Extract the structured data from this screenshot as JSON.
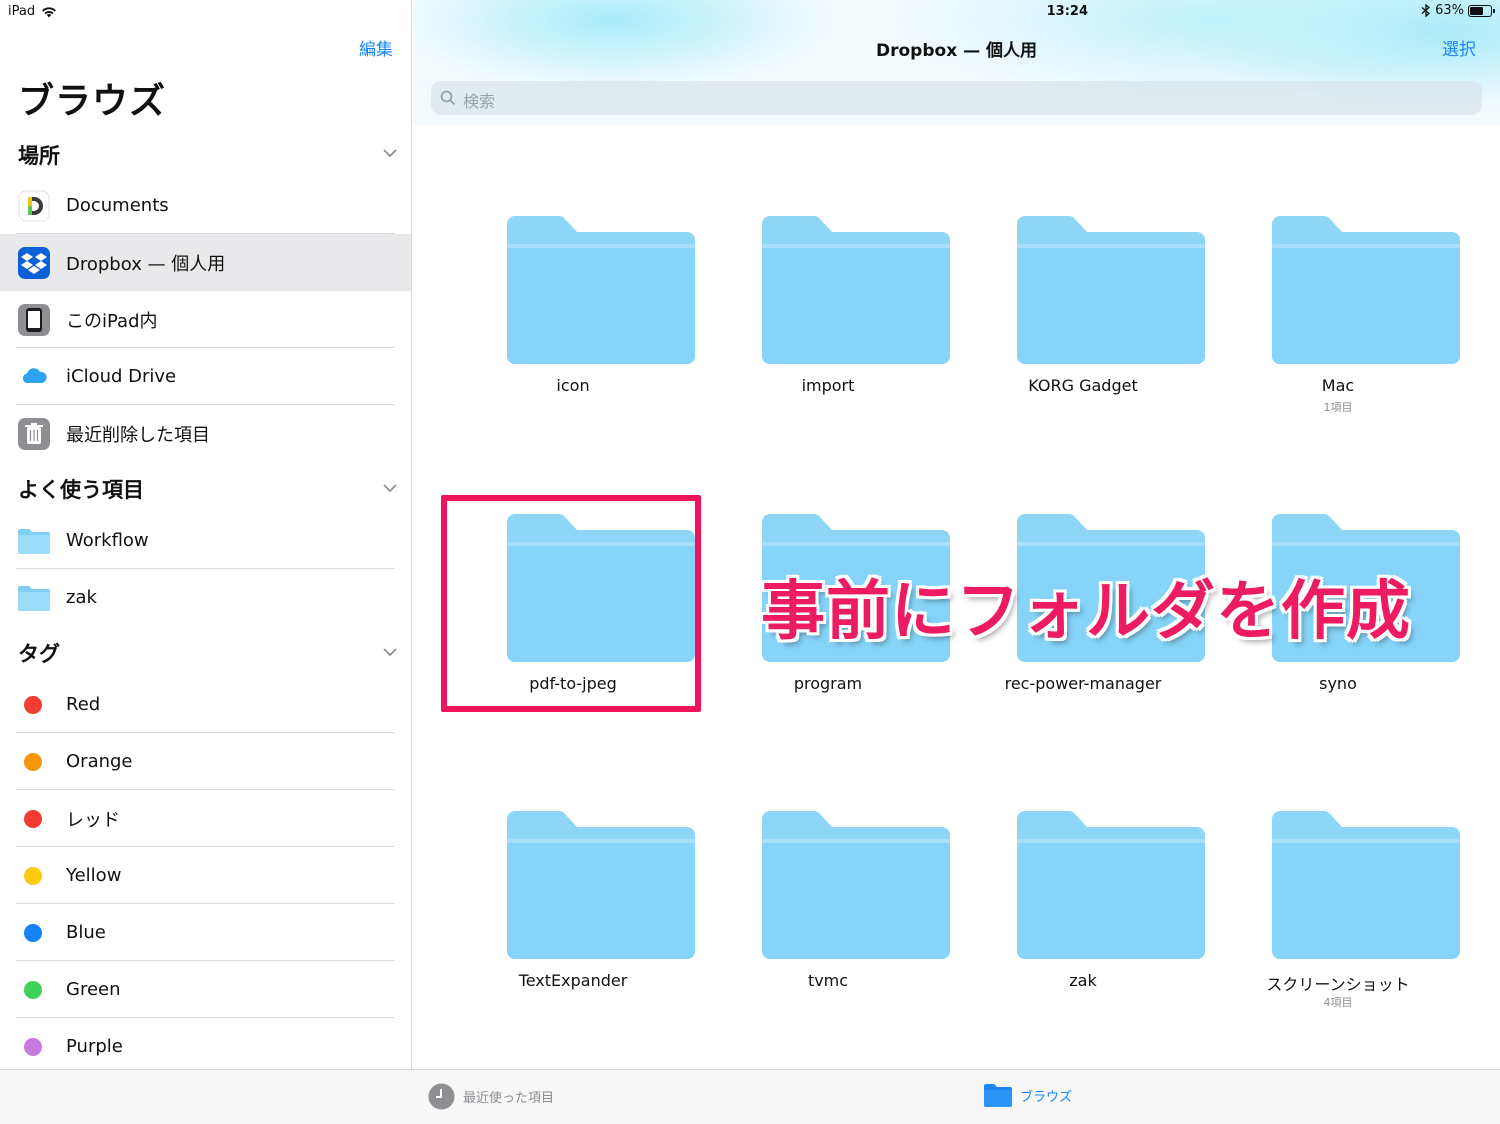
{
  "status": {
    "device": "iPad",
    "time": "13:24",
    "battery": "63%"
  },
  "sidebar": {
    "edit_label": "編集",
    "title": "ブラウズ",
    "locations_header": "場所",
    "locations": [
      {
        "label": "Documents",
        "icon": "documents-app-icon"
      },
      {
        "label": "Dropbox — 個人用",
        "icon": "dropbox-icon",
        "selected": true
      },
      {
        "label": "このiPad内",
        "icon": "ipad-icon"
      },
      {
        "label": "iCloud Drive",
        "icon": "icloud-icon"
      },
      {
        "label": "最近削除した項目",
        "icon": "trash-icon"
      }
    ],
    "favorites_header": "よく使う項目",
    "favorites": [
      {
        "label": "Workflow",
        "icon": "folder-icon"
      },
      {
        "label": "zak",
        "icon": "folder-icon"
      }
    ],
    "tags_header": "タグ",
    "tags": [
      {
        "label": "Red",
        "color": "#f23c32"
      },
      {
        "label": "Orange",
        "color": "#f7950d"
      },
      {
        "label": "レッド",
        "color": "#f23c32"
      },
      {
        "label": "Yellow",
        "color": "#fccb0f"
      },
      {
        "label": "Blue",
        "color": "#1582f5"
      },
      {
        "label": "Green",
        "color": "#3dd258"
      },
      {
        "label": "Purple",
        "color": "#c97ae0"
      }
    ]
  },
  "main": {
    "title": "Dropbox — 個人用",
    "select_label": "選択",
    "search_placeholder": "検索",
    "folders": [
      {
        "name": "icon",
        "sub": ""
      },
      {
        "name": "import",
        "sub": ""
      },
      {
        "name": "KORG Gadget",
        "sub": ""
      },
      {
        "name": "Mac",
        "sub": "1項目"
      },
      {
        "name": "pdf-to-jpeg",
        "sub": ""
      },
      {
        "name": "program",
        "sub": ""
      },
      {
        "name": "rec-power-manager",
        "sub": ""
      },
      {
        "name": "syno",
        "sub": ""
      },
      {
        "name": "TextExpander",
        "sub": ""
      },
      {
        "name": "tvmc",
        "sub": ""
      },
      {
        "name": "zak",
        "sub": ""
      },
      {
        "name": "スクリーンショット",
        "sub": "4項目"
      }
    ],
    "annotation": "事前にフォルダを作成"
  },
  "tabbar": {
    "recent_label": "最近使った項目",
    "browse_label": "ブラウズ"
  },
  "colors": {
    "accent": "#1a87f5",
    "folder": "#8dd7f9",
    "highlight": "#f0145a"
  }
}
